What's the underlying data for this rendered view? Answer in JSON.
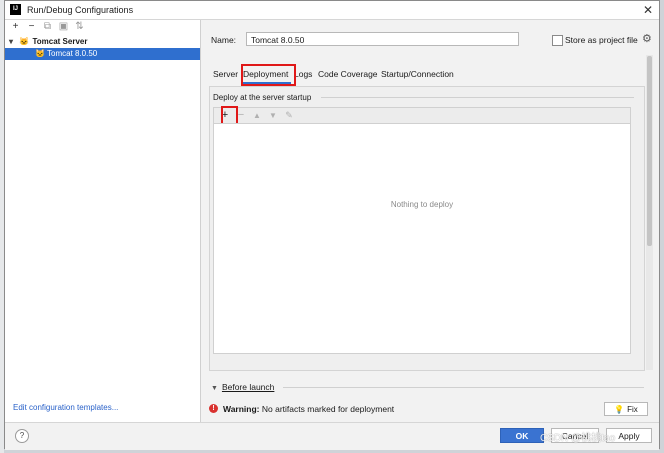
{
  "window": {
    "title": "Run/Debug Configurations",
    "icon_text": "IJ"
  },
  "left": {
    "toolbar": [
      {
        "icon": "plus-icon",
        "glyph": "+"
      },
      {
        "icon": "minus-icon",
        "glyph": "−"
      },
      {
        "icon": "copy-icon",
        "glyph": "⧉"
      },
      {
        "icon": "folder-icon",
        "glyph": "▣"
      },
      {
        "icon": "sort-icon",
        "glyph": "⇅"
      }
    ],
    "tree": {
      "group": "Tomcat Server",
      "child": "Tomcat 8.0.50"
    },
    "edit_templates": "Edit configuration templates..."
  },
  "right": {
    "name_label": "Name:",
    "name_value": "Tomcat 8.0.50",
    "store_label": "Store as project file",
    "tabs": [
      "Server",
      "Deployment",
      "Logs",
      "Code Coverage",
      "Startup/Connection"
    ],
    "active_tab": "Deployment",
    "group_title": "Deploy at the server startup",
    "empty_text": "Nothing to deploy",
    "before_launch": "Before launch",
    "warning_label": "Warning:",
    "warning_text": "No artifacts marked for deployment",
    "fix_label": "Fix"
  },
  "buttons": {
    "help": "?",
    "ok": "OK",
    "cancel": "Cancel",
    "apply": "Apply"
  },
  "watermark": "CSDN @桃桃tao",
  "colors": {
    "accent": "#2f6fcf",
    "highlight_box": "#e01818",
    "error": "#d9322f"
  }
}
